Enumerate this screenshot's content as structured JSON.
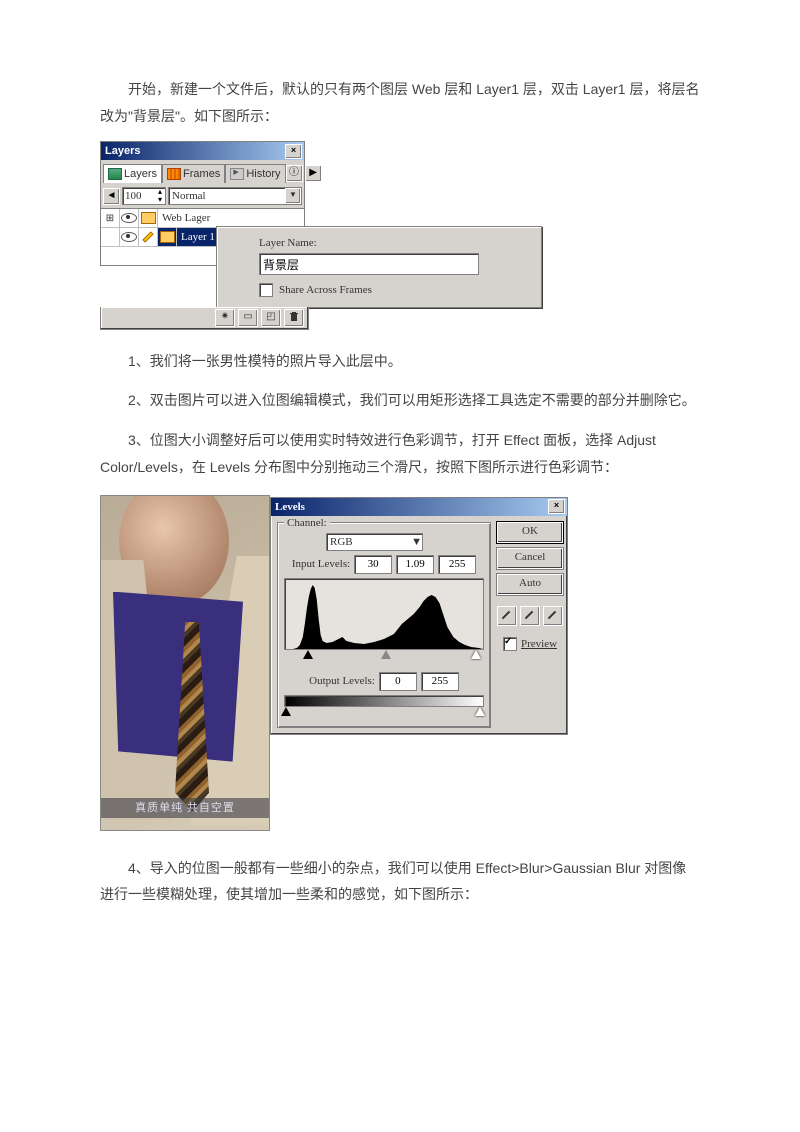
{
  "para1": "开始，新建一个文件后，默认的只有两个图层 Web 层和 Layer1 层，双击 Layer1 层，将层名改为\"背景层\"。如下图所示：",
  "layers": {
    "title": "Layers",
    "tabs": {
      "layers": "Layers",
      "frames": "Frames",
      "history": "History"
    },
    "opacity": "100",
    "blend": "Normal",
    "row1": "Web Lager",
    "row2": "Layer 1",
    "rename_label": "Layer Name:",
    "rename_value": "背景层",
    "share": "Share Across Frames"
  },
  "step1": "1、我们将一张男性模特的照片导入此层中。",
  "step2": "2、双击图片可以进入位图编辑模式，我们可以用矩形选择工具选定不需要的部分并删除它。",
  "step3": "3、位图大小调整好后可以使用实时特效进行色彩调节，打开 Effect 面板，选择 Adjust Color/Levels，在 Levels 分布图中分别拖动三个滑尺，按照下图所示进行色彩调节：",
  "photo_caption": "真质单纯  共自空置",
  "levels": {
    "title": "Levels",
    "channel_label": "Channel:",
    "channel_value": "RGB",
    "input_label": "Input Levels:",
    "in_lo": "30",
    "in_mid": "1.09",
    "in_hi": "255",
    "output_label": "Output Levels:",
    "out_lo": "0",
    "out_hi": "255",
    "ok": "OK",
    "cancel": "Cancel",
    "auto": "Auto",
    "preview": "Preview"
  },
  "step4": "4、导入的位图一般都有一些细小的杂点，我们可以使用 Effect>Blur>Gaussian Blur 对图像进行一些模糊处理，使其增加一些柔和的感觉，如下图所示："
}
